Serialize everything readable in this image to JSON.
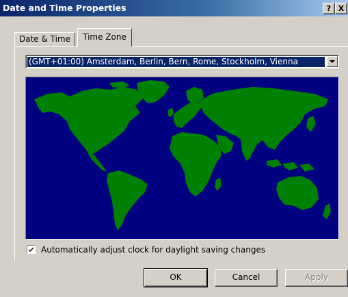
{
  "window": {
    "title": "Date and Time Properties",
    "help_button": "?",
    "close_button": "X"
  },
  "tabs": [
    {
      "label": "Date & Time",
      "active": false
    },
    {
      "label": "Time Zone",
      "active": true
    }
  ],
  "timezone": {
    "selected": "(GMT+01:00) Amsterdam, Berlin, Bern, Rome, Stockholm, Vienna"
  },
  "map": {
    "ocean_color": "#000080",
    "land_color": "#008000"
  },
  "daylight": {
    "label": "Automatically adjust clock for daylight saving changes",
    "checked": true
  },
  "buttons": {
    "ok": "OK",
    "cancel": "Cancel",
    "apply": "Apply"
  }
}
